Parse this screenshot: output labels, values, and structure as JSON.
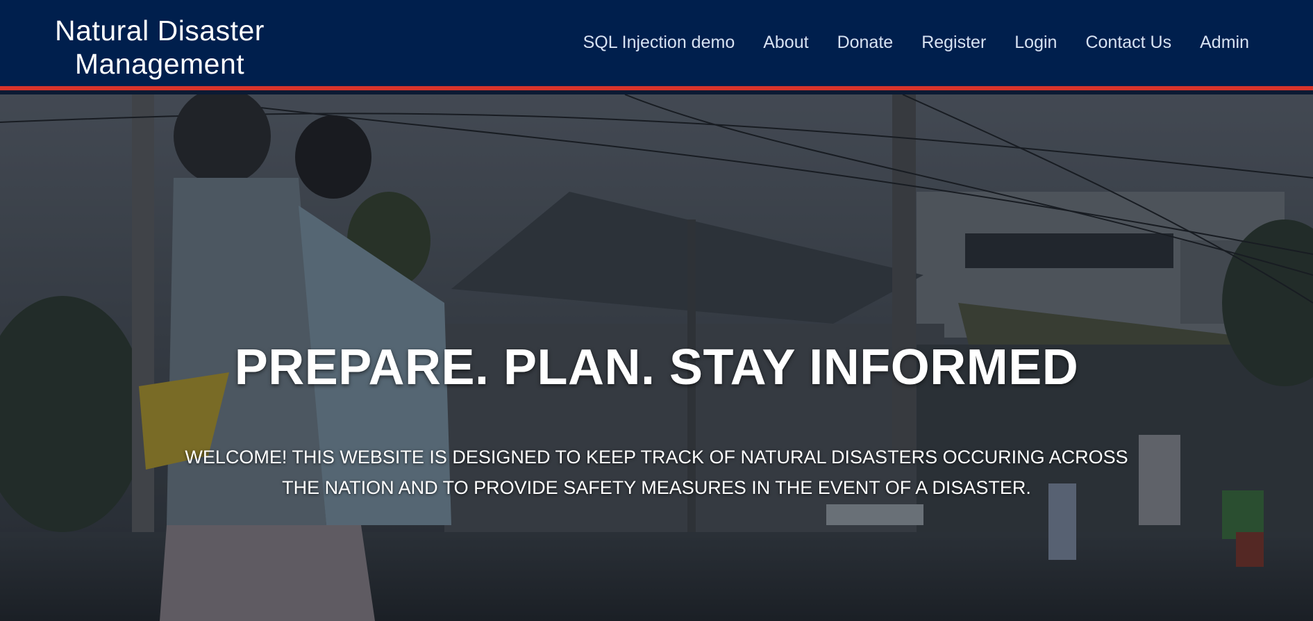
{
  "header": {
    "brand": "Natural Disaster\nManagement",
    "brand_line1": "Natural Disaster",
    "brand_line2": "Management",
    "nav": [
      {
        "label": "SQL Injection demo"
      },
      {
        "label": "About"
      },
      {
        "label": "Donate"
      },
      {
        "label": "Register"
      },
      {
        "label": "Login"
      },
      {
        "label": "Contact Us"
      },
      {
        "label": "Admin"
      }
    ]
  },
  "hero": {
    "title": "PREPARE. PLAN. STAY INFORMED",
    "text": "WELCOME! THIS WEBSITE IS DESIGNED TO KEEP TRACK OF NATURAL DISASTERS OCCURING ACROSS THE NATION AND TO PROVIDE SAFETY MEASURES IN THE EVENT OF A DISASTER."
  },
  "colors": {
    "navbar_bg": "#001f4d",
    "accent_border": "#d9342b",
    "nav_text": "#d7e2f2",
    "hero_text": "#ffffff"
  }
}
